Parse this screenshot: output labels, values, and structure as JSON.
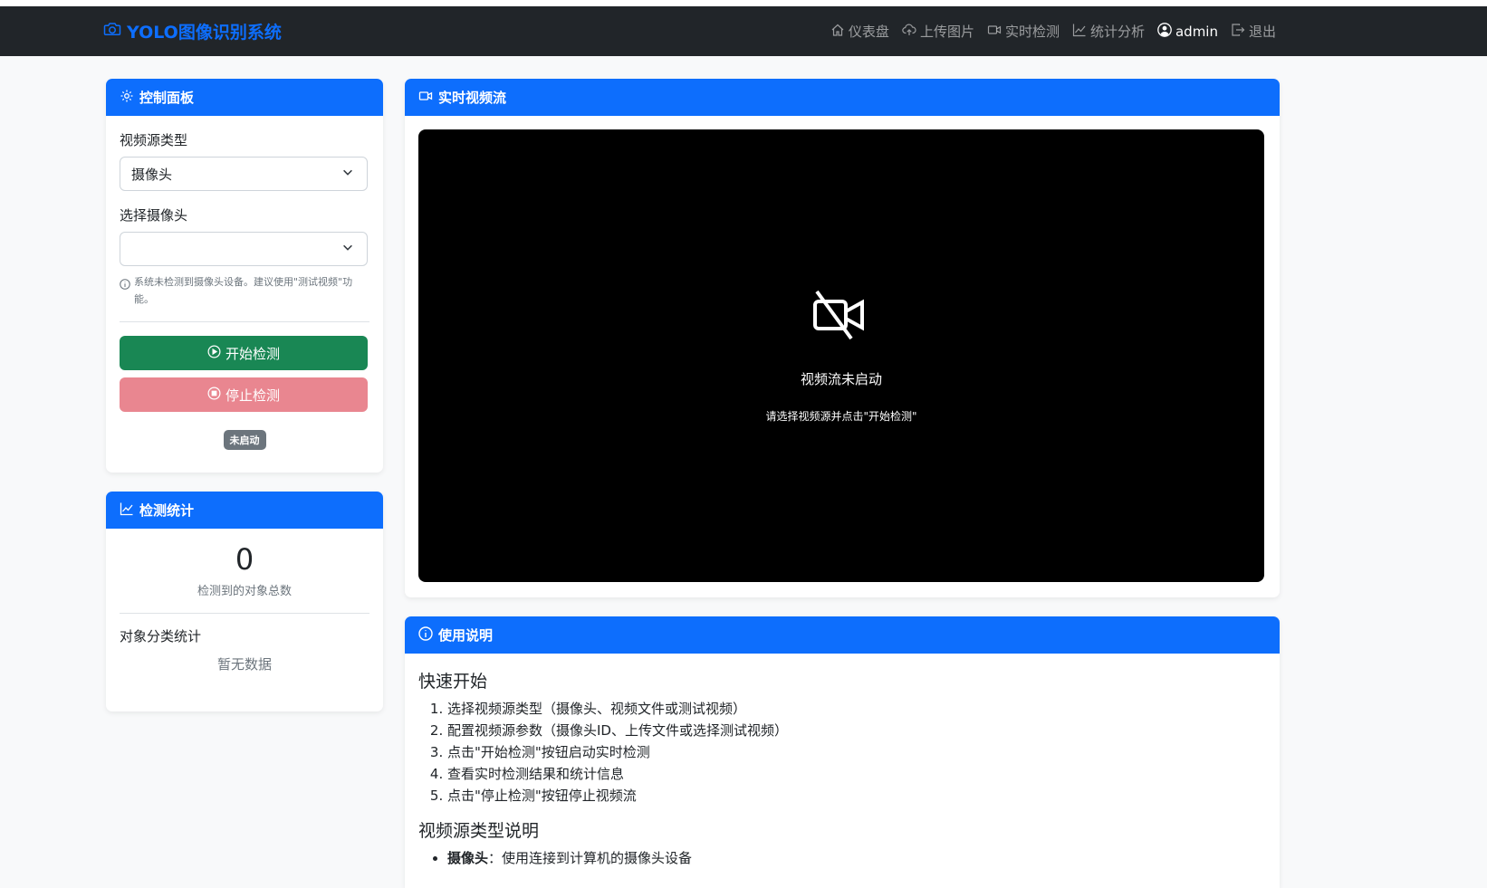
{
  "navbar": {
    "brand": "YOLO图像识别系统",
    "links": {
      "dashboard": "仪表盘",
      "upload": "上传图片",
      "realtime": "实时检测",
      "stats": "统计分析",
      "user": "admin",
      "logout": "退出"
    }
  },
  "control_panel": {
    "title": "控制面板",
    "source_type_label": "视频源类型",
    "source_type_value": "摄像头",
    "camera_label": "选择摄像头",
    "camera_value": "",
    "hint": "系统未检测到摄像头设备。建议使用\"测试视频\"功能。",
    "start_button": "开始检测",
    "stop_button": "停止检测",
    "status_badge": "未启动"
  },
  "stats_panel": {
    "title": "检测统计",
    "total_count": "0",
    "total_label": "检测到的对象总数",
    "category_label": "对象分类统计",
    "no_data": "暂无数据"
  },
  "video_panel": {
    "title": "实时视频流",
    "status_title": "视频流未启动",
    "status_sub": "请选择视频源并点击\"开始检测\""
  },
  "instructions": {
    "title": "使用说明",
    "quick_start_heading": "快速开始",
    "steps": [
      "选择视频源类型（摄像头、视频文件或测试视频）",
      "配置视频源参数（摄像头ID、上传文件或选择测试视频）",
      "点击\"开始检测\"按钮启动实时检测",
      "查看实时检测结果和统计信息",
      "点击\"停止检测\"按钮停止视频流"
    ],
    "types_heading": "视频源类型说明",
    "types": [
      {
        "term": "摄像头",
        "desc": "：使用连接到计算机的摄像头设备"
      }
    ]
  },
  "colors": {
    "primary": "#0d6efd",
    "navbar_bg": "#212529",
    "success": "#198754",
    "danger_disabled": "#e98690",
    "secondary": "#6c757d"
  }
}
